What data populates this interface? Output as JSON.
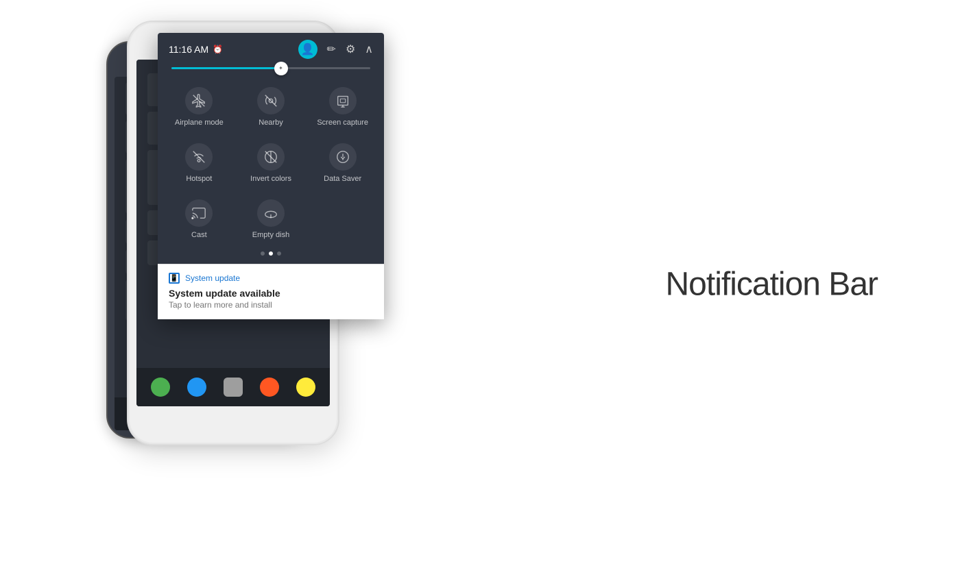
{
  "page": {
    "title": "Notification Bar",
    "background": "#ffffff"
  },
  "panel": {
    "time": "11:16 AM",
    "alarm_icon": "⏰",
    "edit_icon": "✏",
    "settings_icon": "⚙",
    "collapse_icon": "∧",
    "brightness_percent": 55
  },
  "tiles": [
    {
      "id": "airplane-mode",
      "label": "Airplane mode",
      "icon": "airplane"
    },
    {
      "id": "nearby",
      "label": "Nearby",
      "icon": "nearby"
    },
    {
      "id": "screen-capture",
      "label": "Screen capture",
      "icon": "screen-capture"
    },
    {
      "id": "hotspot",
      "label": "Hotspot",
      "icon": "hotspot"
    },
    {
      "id": "invert-colors",
      "label": "Invert colors",
      "icon": "invert"
    },
    {
      "id": "data-saver",
      "label": "Data Saver",
      "icon": "data-saver"
    },
    {
      "id": "cast",
      "label": "Cast",
      "icon": "cast"
    },
    {
      "id": "empty-dish",
      "label": "Empty dish",
      "icon": "dish"
    }
  ],
  "notification": {
    "app_name": "System update",
    "title": "System update available",
    "body": "Tap to learn more and install",
    "icon": "📱"
  },
  "phone_bottom_icons": [
    "phone",
    "home",
    "apps",
    "camera",
    "browser"
  ]
}
